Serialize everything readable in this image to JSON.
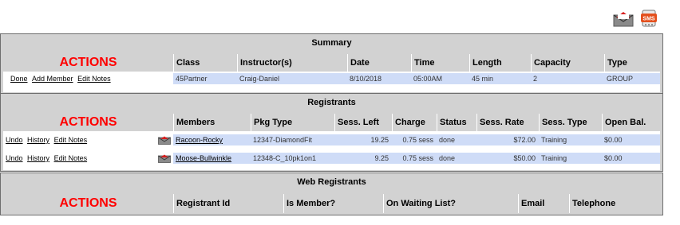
{
  "summary": {
    "title": "Summary",
    "actions_heading": "ACTIONS",
    "columns": [
      "Class",
      "Instructor(s)",
      "Date",
      "Time",
      "Length",
      "Capacity",
      "Type"
    ],
    "links": [
      "Done",
      "Add Member",
      "Edit Notes"
    ],
    "row": [
      "45Partner",
      "Craig-Daniel",
      "8/10/2018",
      "05:00AM",
      "45 min",
      "2",
      "GROUP"
    ]
  },
  "registrants": {
    "title": "Registrants",
    "actions_heading": "ACTIONS",
    "columns": [
      "Members",
      "Pkg Type",
      "Sess. Left",
      "Charge",
      "Status",
      "Sess. Rate",
      "Sess. Type",
      "Open Bal."
    ],
    "rows": [
      {
        "links": [
          "Undo",
          "History",
          "Edit Notes"
        ],
        "member": "Racoon-Rocky",
        "pkg_type": "12347-DiamondFit",
        "sess_left": "19.25",
        "charge": "0.75 sess",
        "status": "done",
        "sess_rate": "$72.00",
        "sess_type": "Training",
        "open_bal": "$0.00"
      },
      {
        "links": [
          "Undo",
          "History",
          "Edit Notes"
        ],
        "member": "Moose-Bullwinkle",
        "pkg_type": "12348-C_10pk1on1",
        "sess_left": "9.25",
        "charge": "0.75 sess",
        "status": "done",
        "sess_rate": "$50.00",
        "sess_type": "Training",
        "open_bal": "$0.00"
      }
    ]
  },
  "web_registrants": {
    "title": "Web Registrants",
    "actions_heading": "ACTIONS",
    "columns": [
      "Registrant Id",
      "Is Member?",
      "On Waiting List?",
      "Email",
      "Telephone"
    ]
  },
  "icons": {
    "mail": "email-icon",
    "sms": "sms-icon",
    "row_mail": "envelope-icon"
  },
  "colors": {
    "actions": "#ff0000",
    "row_highlight": "#cfdcf7",
    "panel": "#d2d2d2"
  }
}
